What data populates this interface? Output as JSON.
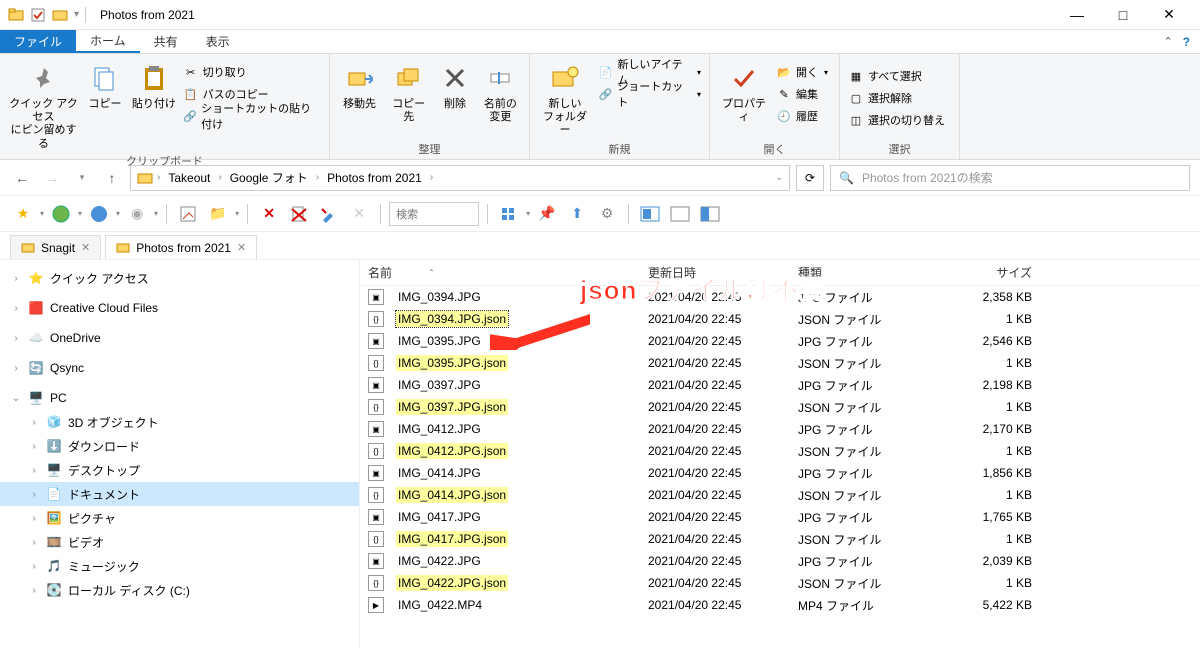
{
  "window": {
    "title": "Photos from 2021",
    "minimize": "—",
    "maximize": "□",
    "close": "✕"
  },
  "tabs": {
    "file": "ファイル",
    "home": "ホーム",
    "share": "共有",
    "view": "表示"
  },
  "ribbon": {
    "clipboard": {
      "label": "クリップボード",
      "pin": "クイック アクセス\nにピン留めする",
      "copy": "コピー",
      "paste": "貼り付け",
      "cut": "切り取り",
      "copypath": "パスのコピー",
      "pasteshortcut": "ショートカットの貼り付け"
    },
    "organize": {
      "label": "整理",
      "moveto": "移動先",
      "copyto": "コピー先",
      "delete": "削除",
      "rename": "名前の\n変更"
    },
    "new": {
      "label": "新規",
      "newfolder": "新しい\nフォルダー",
      "newitem": "新しいアイテム",
      "shortcut": "ショートカット"
    },
    "open": {
      "label": "開く",
      "properties": "プロパティ",
      "open": "開く",
      "edit": "編集",
      "history": "履歴"
    },
    "select": {
      "label": "選択",
      "selectall": "すべて選択",
      "selectnone": "選択解除",
      "invertselection": "選択の切り替え"
    }
  },
  "address": {
    "crumbs": [
      "Takeout",
      "Google フォト",
      "Photos from 2021"
    ],
    "search_placeholder": "Photos from 2021の検索"
  },
  "toolbar2": {
    "search": "検索"
  },
  "filetabs": {
    "left": "Snagit",
    "right": "Photos from 2021"
  },
  "sidebar": {
    "items": [
      {
        "label": "クイック アクセス",
        "icon": "star",
        "exp": ">",
        "depth": 0
      },
      {
        "label": "Creative Cloud Files",
        "icon": "cc",
        "exp": ">",
        "depth": 0
      },
      {
        "label": "OneDrive",
        "icon": "cloud",
        "exp": ">",
        "depth": 0
      },
      {
        "label": "Qsync",
        "icon": "sync",
        "exp": ">",
        "depth": 0
      },
      {
        "label": "PC",
        "icon": "pc",
        "exp": "v",
        "depth": 0
      },
      {
        "label": "3D オブジェクト",
        "icon": "3d",
        "exp": ">",
        "depth": 1
      },
      {
        "label": "ダウンロード",
        "icon": "download",
        "exp": ">",
        "depth": 1
      },
      {
        "label": "デスクトップ",
        "icon": "desktop",
        "exp": ">",
        "depth": 1
      },
      {
        "label": "ドキュメント",
        "icon": "document",
        "exp": ">",
        "depth": 1,
        "selected": true
      },
      {
        "label": "ピクチャ",
        "icon": "picture",
        "exp": ">",
        "depth": 1
      },
      {
        "label": "ビデオ",
        "icon": "video",
        "exp": ">",
        "depth": 1
      },
      {
        "label": "ミュージック",
        "icon": "music",
        "exp": ">",
        "depth": 1
      },
      {
        "label": "ローカル ディスク (C:)",
        "icon": "disk",
        "exp": ">",
        "depth": 1
      }
    ]
  },
  "columns": {
    "name": "名前",
    "date": "更新日時",
    "type": "種類",
    "size": "サイズ"
  },
  "files": [
    {
      "name": "IMG_0394.JPG",
      "date": "2021/04/20 22:45",
      "type": "JPG ファイル",
      "size": "2,358 KB",
      "hl": false
    },
    {
      "name": "IMG_0394.JPG.json",
      "date": "2021/04/20 22:45",
      "type": "JSON ファイル",
      "size": "1 KB",
      "hl": true,
      "focused": true
    },
    {
      "name": "IMG_0395.JPG",
      "date": "2021/04/20 22:45",
      "type": "JPG ファイル",
      "size": "2,546 KB",
      "hl": false
    },
    {
      "name": "IMG_0395.JPG.json",
      "date": "2021/04/20 22:45",
      "type": "JSON ファイル",
      "size": "1 KB",
      "hl": true
    },
    {
      "name": "IMG_0397.JPG",
      "date": "2021/04/20 22:45",
      "type": "JPG ファイル",
      "size": "2,198 KB",
      "hl": false
    },
    {
      "name": "IMG_0397.JPG.json",
      "date": "2021/04/20 22:45",
      "type": "JSON ファイル",
      "size": "1 KB",
      "hl": true
    },
    {
      "name": "IMG_0412.JPG",
      "date": "2021/04/20 22:45",
      "type": "JPG ファイル",
      "size": "2,170 KB",
      "hl": false
    },
    {
      "name": "IMG_0412.JPG.json",
      "date": "2021/04/20 22:45",
      "type": "JSON ファイル",
      "size": "1 KB",
      "hl": true
    },
    {
      "name": "IMG_0414.JPG",
      "date": "2021/04/20 22:45",
      "type": "JPG ファイル",
      "size": "1,856 KB",
      "hl": false
    },
    {
      "name": "IMG_0414.JPG.json",
      "date": "2021/04/20 22:45",
      "type": "JSON ファイル",
      "size": "1 KB",
      "hl": true
    },
    {
      "name": "IMG_0417.JPG",
      "date": "2021/04/20 22:45",
      "type": "JPG ファイル",
      "size": "1,765 KB",
      "hl": false
    },
    {
      "name": "IMG_0417.JPG.json",
      "date": "2021/04/20 22:45",
      "type": "JSON ファイル",
      "size": "1 KB",
      "hl": true
    },
    {
      "name": "IMG_0422.JPG",
      "date": "2021/04/20 22:45",
      "type": "JPG ファイル",
      "size": "2,039 KB",
      "hl": false
    },
    {
      "name": "IMG_0422.JPG.json",
      "date": "2021/04/20 22:45",
      "type": "JSON ファイル",
      "size": "1 KB",
      "hl": true
    },
    {
      "name": "IMG_0422.MP4",
      "date": "2021/04/20 22:45",
      "type": "MP4 ファイル",
      "size": "5,422 KB",
      "hl": false
    }
  ],
  "annotation": {
    "text": "jsonファイルは不要"
  }
}
